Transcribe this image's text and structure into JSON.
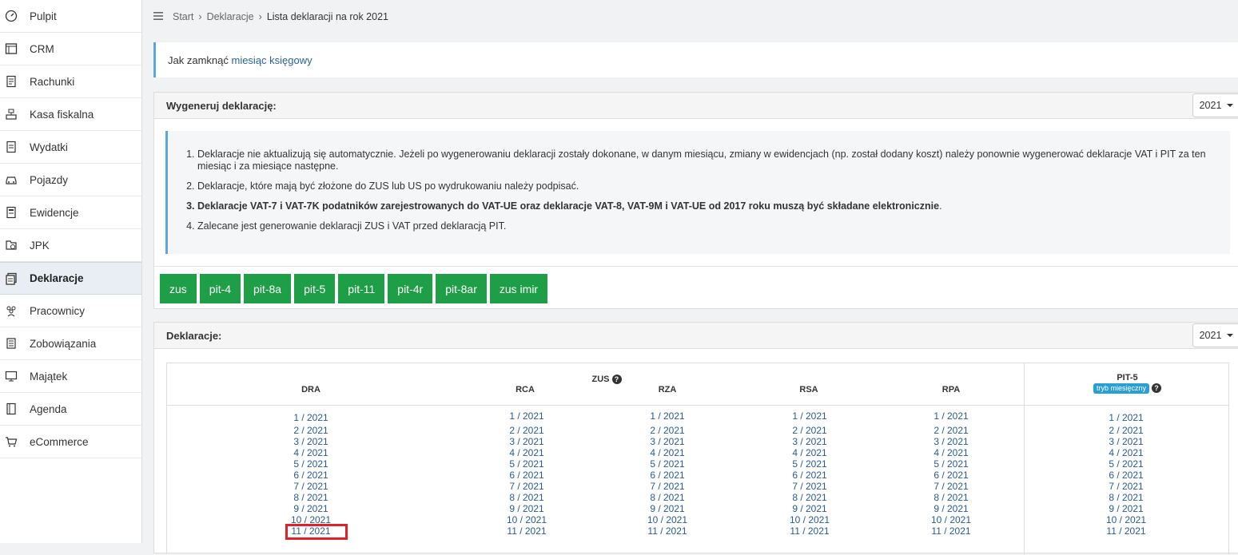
{
  "sidebar": {
    "items": [
      {
        "label": "Pulpit",
        "icon": "dashboard-icon"
      },
      {
        "label": "CRM",
        "icon": "crm-icon"
      },
      {
        "label": "Rachunki",
        "icon": "receipt-icon"
      },
      {
        "label": "Kasa fiskalna",
        "icon": "cash-register-icon"
      },
      {
        "label": "Wydatki",
        "icon": "expenses-icon"
      },
      {
        "label": "Pojazdy",
        "icon": "car-icon"
      },
      {
        "label": "Ewidencje",
        "icon": "ledger-icon"
      },
      {
        "label": "JPK",
        "icon": "jpk-icon"
      },
      {
        "label": "Deklaracje",
        "icon": "declarations-icon",
        "active": true
      },
      {
        "label": "Pracownicy",
        "icon": "employees-icon"
      },
      {
        "label": "Zobowiązania",
        "icon": "liabilities-icon"
      },
      {
        "label": "Majątek",
        "icon": "assets-icon"
      },
      {
        "label": "Agenda",
        "icon": "agenda-icon"
      },
      {
        "label": "eCommerce",
        "icon": "cart-icon"
      }
    ]
  },
  "breadcrumb": {
    "start": "Start",
    "section": "Deklaracje",
    "current": "Lista deklaracji na rok 2021"
  },
  "info": {
    "text": "Jak zamknąć ",
    "link": "miesiąc księgowy"
  },
  "generate": {
    "title": "Wygeneruj deklarację:",
    "year": "2021",
    "notes": {
      "n1": "Deklaracje nie aktualizują się automatycznie. Jeżeli po wygenerowaniu deklaracji zostały dokonane, w danym miesiącu, zmiany w ewidencjach (np. został dodany koszt) należy ponownie wygenerować deklaracje VAT i PIT za ten miesiąc i za miesiące następne.",
      "n2": "Deklaracje, które mają być złożone do ZUS lub US po wydrukowaniu należy podpisać.",
      "n3_bold": "Deklaracje VAT-7 i VAT-7K podatników zarejestrowanych do VAT-UE oraz deklaracje VAT-8, VAT-9M i VAT-UE od 2017 roku muszą być składane elektronicznie",
      "n3_tail": ".",
      "n4": "Zalecane jest generowanie deklaracji ZUS i VAT przed deklaracją PIT."
    },
    "buttons": [
      "zus",
      "pit-4",
      "pit-8a",
      "pit-5",
      "pit-11",
      "pit-4r",
      "pit-8ar",
      "zus imir"
    ]
  },
  "declarations": {
    "title": "Deklaracje:",
    "year": "2021",
    "zus_group": "ZUS",
    "pit_group": "PIT-5",
    "pit_badge": "tryb miesięczny",
    "columns": {
      "dra": "DRA",
      "rca": "RCA",
      "rza": "RZA",
      "rsa": "RSA",
      "rpa": "RPA"
    },
    "periods": [
      "1 / 2021",
      "2 / 2021",
      "3 / 2021",
      "4 / 2021",
      "5 / 2021",
      "6 / 2021",
      "7 / 2021",
      "8 / 2021",
      "9 / 2021",
      "10 / 2021",
      "11 / 2021"
    ]
  }
}
